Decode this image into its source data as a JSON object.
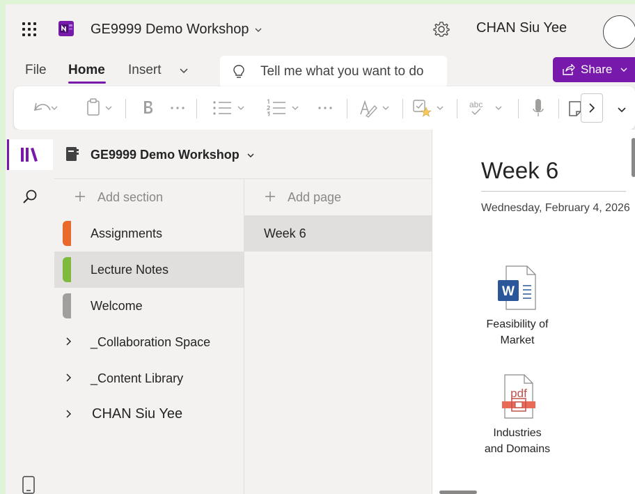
{
  "titlebar": {
    "notebook_title": "GE9999 Demo Workshop",
    "username": "CHAN Siu Yee"
  },
  "ribbon": {
    "tabs": [
      {
        "label": "File"
      },
      {
        "label": "Home"
      },
      {
        "label": "Insert"
      }
    ],
    "tell_me_placeholder": "Tell me what you want to do",
    "share_label": "Share",
    "accent_color": "#7719aa"
  },
  "toolbar": {
    "format_label": "abc"
  },
  "navigation": {
    "notebook_name": "GE9999 Demo Workshop",
    "add_section_label": "Add section",
    "add_page_label": "Add page",
    "sections": [
      {
        "label": "Assignments",
        "color": "#e8692b"
      },
      {
        "label": "Lecture Notes",
        "color": "#7fba3f"
      },
      {
        "label": "Welcome",
        "color": "#a19f9d"
      }
    ],
    "section_groups": [
      {
        "label": "_Collaboration Space"
      },
      {
        "label": "_Content Library"
      },
      {
        "label": "CHAN Siu Yee"
      }
    ],
    "pages": [
      {
        "label": "Week 6"
      }
    ]
  },
  "page": {
    "title": "Week 6",
    "date": "Wednesday, February 4, 2026",
    "attachments": [
      {
        "name_line1": "Feasibility of",
        "name_line2": "Market",
        "type": "word-doc-icon",
        "badge": "W"
      },
      {
        "name_line1": "Industries",
        "name_line2": "and Domains",
        "type": "pdf-icon",
        "badge": "pdf"
      }
    ]
  }
}
